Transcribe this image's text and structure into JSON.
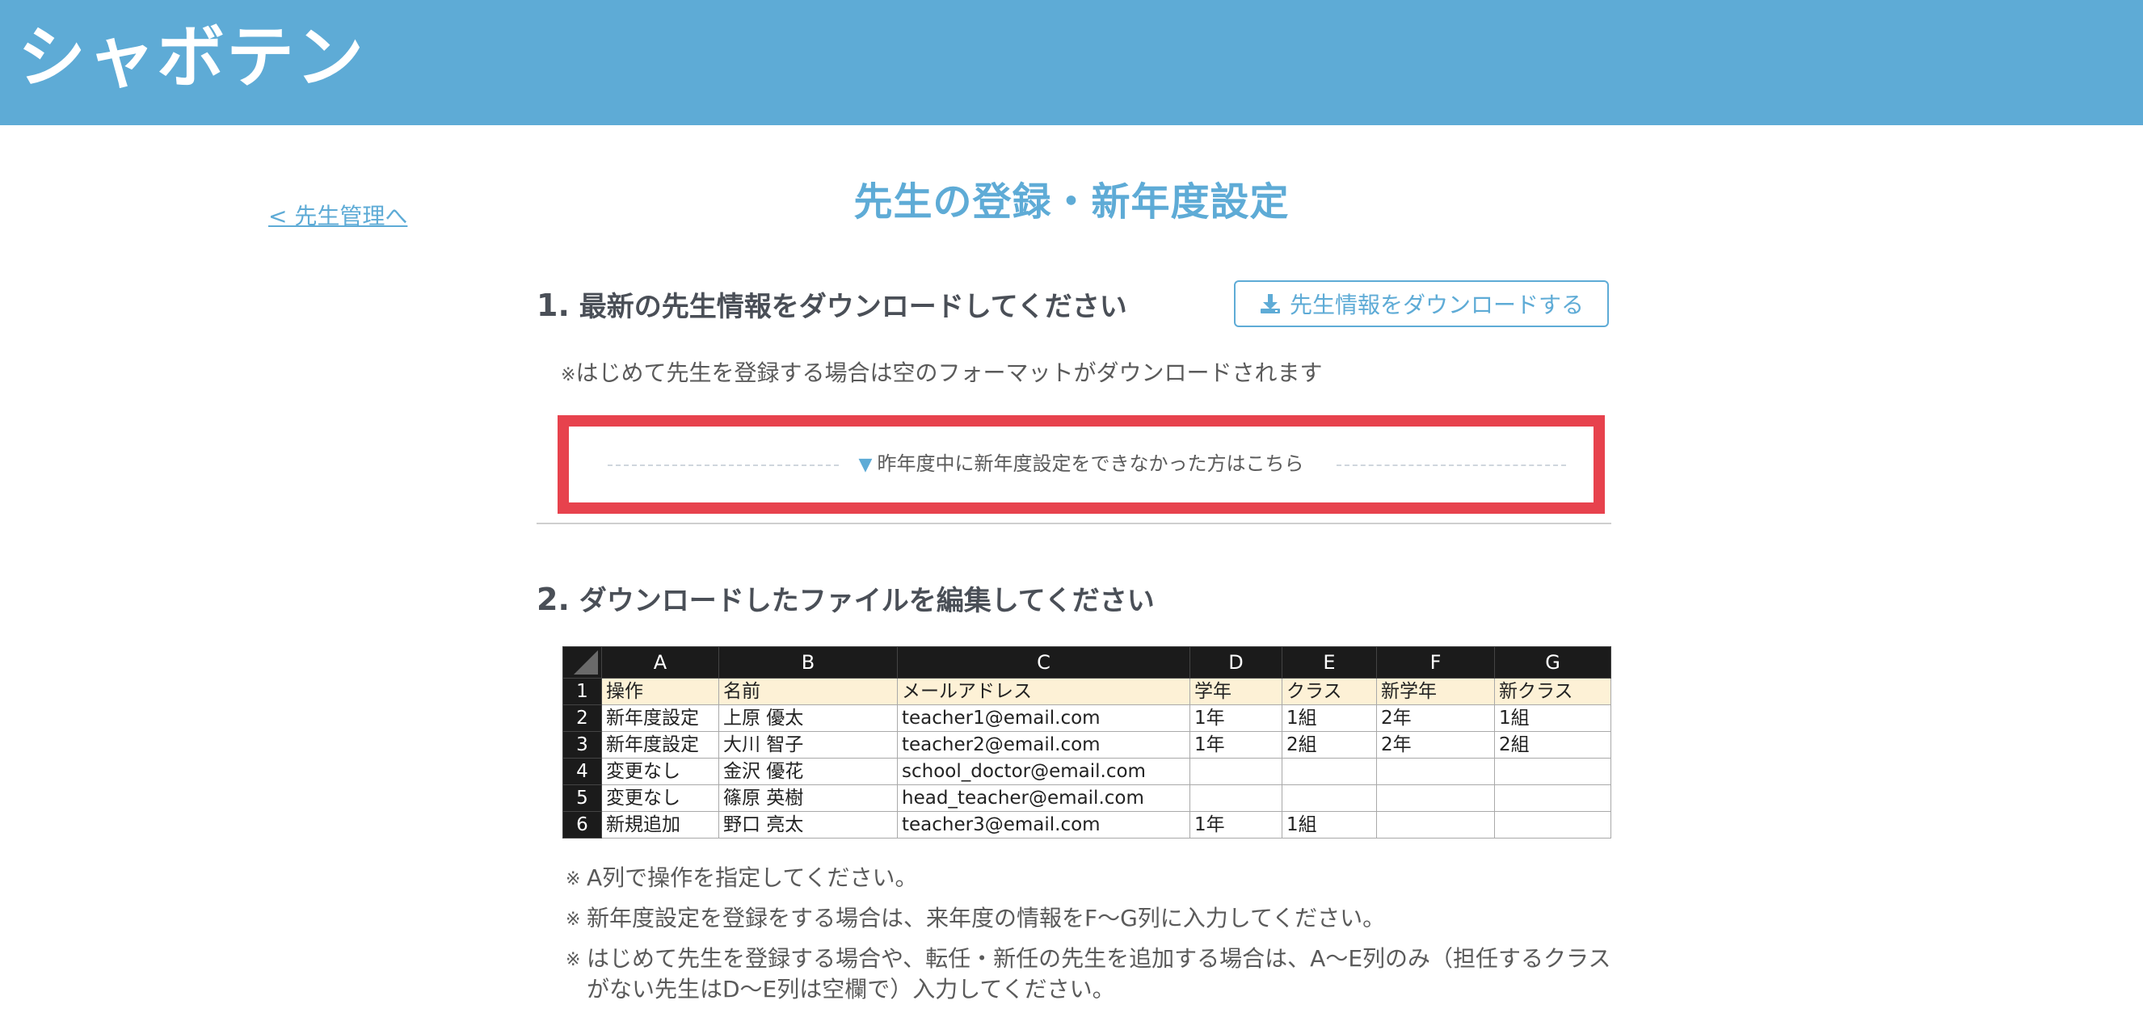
{
  "header": {
    "logo_text": "シャボテン",
    "bg_color": "#5eabd6"
  },
  "nav": {
    "back_link": "< 先生管理へ"
  },
  "page": {
    "title": "先生の登録・新年度設定"
  },
  "section1": {
    "number": "1.",
    "heading": "最新の先生情報をダウンロードしてください",
    "download_button": "先生情報をダウンロードする",
    "download_icon": "download-icon",
    "note_mark": "※",
    "note": "はじめて先生を登録する場合は空のフォーマットがダウンロードされます",
    "toggle_arrow": "▼",
    "toggle_label": "昨年度中に新年度設定をできなかった方はこちら"
  },
  "section2": {
    "number": "2.",
    "heading": "ダウンロードしたファイルを編集してください"
  },
  "sheet": {
    "columns": [
      "A",
      "B",
      "C",
      "D",
      "E",
      "F",
      "G"
    ],
    "rows": [
      {
        "num": "1",
        "cells": [
          "操作",
          "名前",
          "メールアドレス",
          "学年",
          "クラス",
          "新学年",
          "新クラス"
        ]
      },
      {
        "num": "2",
        "cells": [
          "新年度設定",
          "上原 優太",
          "teacher1@email.com",
          "1年",
          "1組",
          "2年",
          "1組"
        ]
      },
      {
        "num": "3",
        "cells": [
          "新年度設定",
          "大川 智子",
          "teacher2@email.com",
          "1年",
          "2組",
          "2年",
          "2組"
        ]
      },
      {
        "num": "4",
        "cells": [
          "変更なし",
          "金沢 優花",
          "school_doctor@email.com",
          "",
          "",
          "",
          ""
        ]
      },
      {
        "num": "5",
        "cells": [
          "変更なし",
          "篠原 英樹",
          "head_teacher@email.com",
          "",
          "",
          "",
          ""
        ]
      },
      {
        "num": "6",
        "cells": [
          "新規追加",
          "野口 亮太",
          "teacher3@email.com",
          "1年",
          "1組",
          "",
          ""
        ]
      }
    ]
  },
  "instructions": {
    "mark": "※",
    "items": [
      "A列で操作を指定してください。",
      "新年度設定を登録をする場合は、来年度の情報をF〜G列に入力してください。",
      "はじめて先生を登録する場合や、転任・新任の先生を追加する場合は、A〜E列のみ（担任するクラスがない先生はD〜E列は空欄で）入力してください。"
    ]
  },
  "colors": {
    "accent": "#5eabd6",
    "highlight": "#e7424d",
    "sheet_header": "#1b1b1b",
    "sheet_label_row": "#fdf1d6"
  }
}
